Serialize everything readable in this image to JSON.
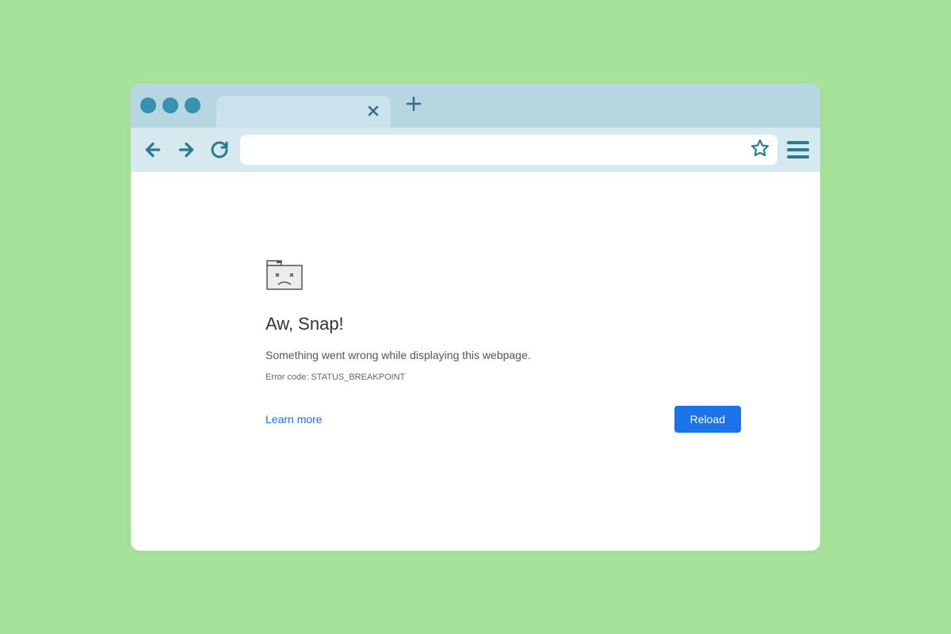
{
  "error": {
    "title": "Aw, Snap!",
    "message": "Something went wrong while displaying this webpage.",
    "code": "Error code: STATUS_BREAKPOINT",
    "learn_more": "Learn more",
    "reload": "Reload"
  }
}
